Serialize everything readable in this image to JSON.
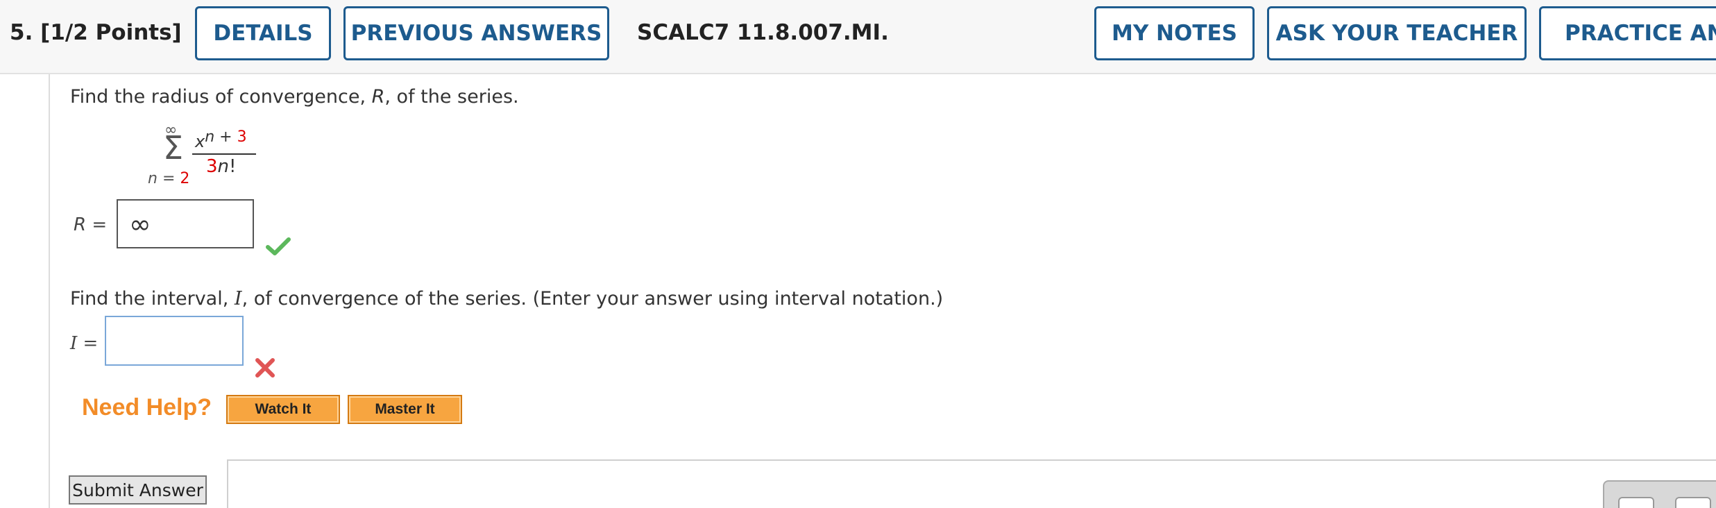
{
  "header": {
    "question_number": "5.",
    "points": "[1/2 Points]",
    "buttons": {
      "details": "DETAILS",
      "previous_answers": "PREVIOUS ANSWERS",
      "my_notes": "MY NOTES",
      "ask_teacher": "ASK YOUR TEACHER",
      "practice": "PRACTICE ANOTHER"
    },
    "code": "SCALC7 11.8.007.MI."
  },
  "question": {
    "prompt_radius_pre": "Find the radius of convergence, ",
    "prompt_radius_var": "R",
    "prompt_radius_post": ", of the series.",
    "series": {
      "sum_upper": "∞",
      "sum_lower_var": "n",
      "sum_lower_eq": " = ",
      "sum_lower_val": "2",
      "numer_base": "x",
      "numer_exp_var": "n",
      "numer_exp_op": " + ",
      "numer_exp_val": "3",
      "denom_coef": "3",
      "denom_var": "n",
      "denom_fact": "!"
    },
    "r_label": "R =",
    "r_answer": "∞",
    "prompt_interval_pre": "Find the interval, ",
    "prompt_interval_var": "I",
    "prompt_interval_post": ", of convergence of the series. (Enter your answer using interval notation.)",
    "i_label": "I =",
    "i_answer": ""
  },
  "help": {
    "label": "Need Help?",
    "watch": "Watch It",
    "master": "Master It"
  },
  "submit_label": "Submit Answer",
  "colors": {
    "header_blue": "#1d5b8e",
    "correct_green": "#5cb85c",
    "incorrect_red": "#e05555",
    "help_orange": "#f28c28",
    "highlight_red": "#dd0000"
  }
}
